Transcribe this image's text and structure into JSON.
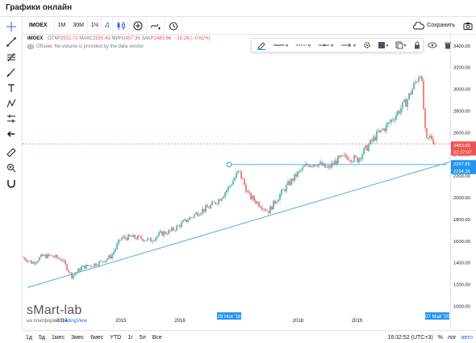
{
  "page": {
    "title": "Графики онлайн"
  },
  "toolbar": {
    "symbol": "IMOEX",
    "intervals": [
      "1M",
      "30M",
      "1Ч",
      "Д"
    ],
    "active_interval": "Д",
    "save_label": "Сохранить"
  },
  "legend": {
    "symbol": "IMOEX",
    "open_label": "ОТКР",
    "open": "2532.72",
    "high_label": "МАКС",
    "high": "2555.43",
    "low_label": "МИН",
    "low": "2457.36",
    "close_label": "ЗАКР",
    "close": "2483.66",
    "change": "−15.28 (−0.61%)",
    "volume_note": "Объём: No volume is provided by the data vendor."
  },
  "price_axis": {
    "ticks": [
      "3400.00",
      "3200.00",
      "3000.00",
      "2800.00",
      "2600.00",
      "2400.00",
      "2200.00",
      "2000.00",
      "1800.00",
      "1600.00",
      "1400.00",
      "1200.00",
      "1000.00"
    ],
    "last_price": "2483.66",
    "countdown": "02:27:07",
    "line_prices": [
      "2297.85",
      "2294.36"
    ]
  },
  "time_axis": {
    "ticks": [
      "2014",
      "2015",
      "2016",
      "2018",
      "2019"
    ],
    "marker_start": "29 Ноя '16",
    "marker_end": "07 Май '20"
  },
  "bottom": {
    "ranges": [
      "1д",
      "5д",
      "1мес",
      "3мес",
      "6мес",
      "YTD",
      "1г",
      "5л",
      "Все"
    ],
    "clock": "16:32:52 (UTC+3)",
    "percent": "%",
    "log": "лог",
    "auto": "авто"
  },
  "watermark": {
    "brand": "sMart-lab",
    "sub_prefix": "на платформе",
    "sub_link": "TradingView"
  },
  "colors": {
    "up": "#26a69a",
    "down": "#ef5350",
    "trendline": "#4fb0df",
    "accent": "#2962ff",
    "last_price_bg": "#ef5350",
    "line_label_bg": "#2196f3"
  },
  "chart_data": {
    "type": "candlestick",
    "symbol": "IMOEX",
    "ylim": [
      1000,
      3400
    ],
    "x": [
      "2013-05",
      "2013-07",
      "2013-09",
      "2013-11",
      "2014-01",
      "2014-03",
      "2014-05",
      "2014-07",
      "2014-09",
      "2014-11",
      "2015-01",
      "2015-03",
      "2015-05",
      "2015-07",
      "2015-09",
      "2015-11",
      "2016-01",
      "2016-03",
      "2016-05",
      "2016-07",
      "2016-09",
      "2016-11",
      "2017-01",
      "2017-03",
      "2017-05",
      "2017-07",
      "2017-09",
      "2017-11",
      "2018-01",
      "2018-03",
      "2018-05",
      "2018-07",
      "2018-09",
      "2018-11",
      "2019-01",
      "2019-03",
      "2019-05",
      "2019-07",
      "2019-09",
      "2019-11",
      "2020-01",
      "2020-02",
      "2020-03",
      "2020-04",
      "2020-05"
    ],
    "close": [
      1470,
      1420,
      1480,
      1480,
      1450,
      1300,
      1380,
      1400,
      1430,
      1480,
      1640,
      1650,
      1640,
      1620,
      1680,
      1700,
      1760,
      1820,
      1880,
      1920,
      1990,
      2100,
      2240,
      2020,
      1950,
      1880,
      2010,
      2120,
      2220,
      2300,
      2310,
      2260,
      2340,
      2370,
      2340,
      2450,
      2560,
      2640,
      2750,
      2860,
      3040,
      3140,
      2500,
      2550,
      2484
    ],
    "trendline": {
      "start": {
        "date": "2013-06",
        "price": 1200
      },
      "end": {
        "date": "2020-05",
        "price": 2294
      }
    },
    "horizontal_line": {
      "from": "29 Ноя '16",
      "to": "07 Май '20",
      "price": 2297.85
    }
  }
}
